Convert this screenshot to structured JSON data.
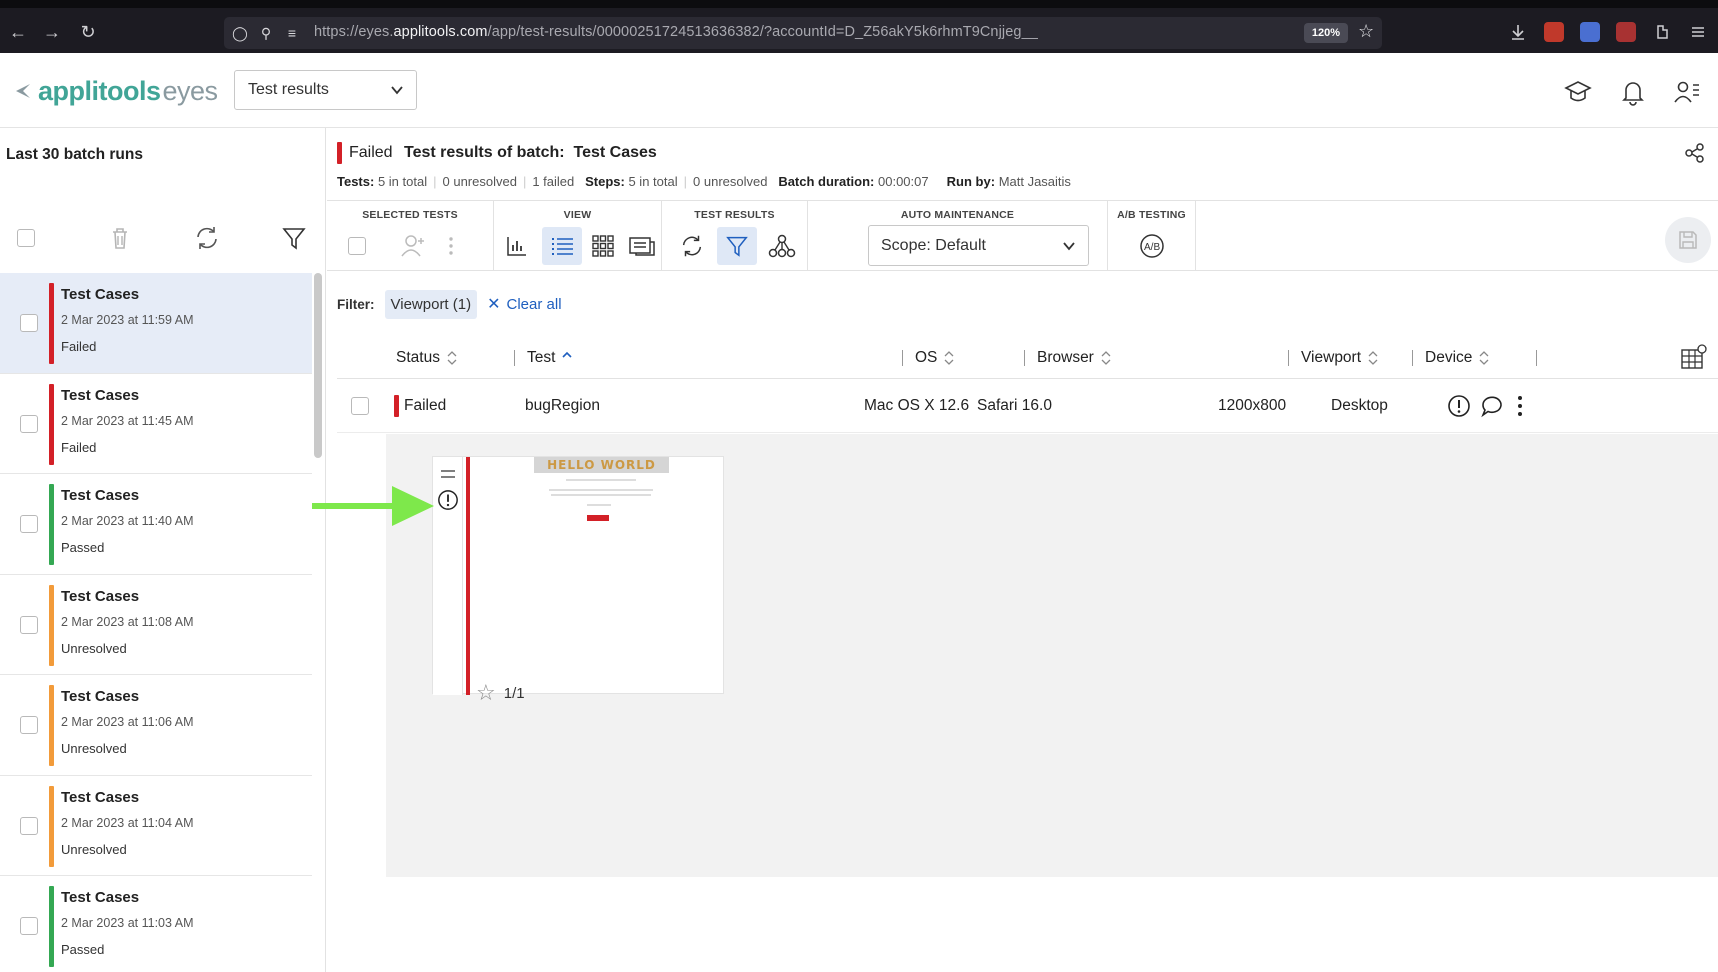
{
  "browser": {
    "url_prefix": "https://eyes.",
    "url_domain": "applitools.com",
    "url_path": "/app/test-results/00000251724513636382/?accountId=D_Z56akY5k6rhmT9Cnjjeg__",
    "zoom": "120%"
  },
  "header": {
    "logo_primary": "applitools",
    "logo_secondary": "eyes",
    "page_select": "Test results"
  },
  "sidebar": {
    "title": "Last 30 batch runs",
    "batches": [
      {
        "name": "Test Cases",
        "date": "2 Mar 2023 at 11:59 AM",
        "status": "Failed",
        "color": "#d32027",
        "active": true
      },
      {
        "name": "Test Cases",
        "date": "2 Mar 2023 at 11:45 AM",
        "status": "Failed",
        "color": "#d32027",
        "active": false
      },
      {
        "name": "Test Cases",
        "date": "2 Mar 2023 at 11:40 AM",
        "status": "Passed",
        "color": "#34a853",
        "active": false
      },
      {
        "name": "Test Cases",
        "date": "2 Mar 2023 at 11:08 AM",
        "status": "Unresolved",
        "color": "#f29b3a",
        "active": false
      },
      {
        "name": "Test Cases",
        "date": "2 Mar 2023 at 11:06 AM",
        "status": "Unresolved",
        "color": "#f29b3a",
        "active": false
      },
      {
        "name": "Test Cases",
        "date": "2 Mar 2023 at 11:04 AM",
        "status": "Unresolved",
        "color": "#f29b3a",
        "active": false
      },
      {
        "name": "Test Cases",
        "date": "2 Mar 2023 at 11:03 AM",
        "status": "Passed",
        "color": "#34a853",
        "active": false
      }
    ]
  },
  "batch": {
    "status": "Failed",
    "title_label": "Test results of batch:",
    "title_name": "Test Cases",
    "tests_label": "Tests:",
    "tests_total": "5 in total",
    "tests_unresolved": "0 unresolved",
    "tests_failed": "1 failed",
    "steps_label": "Steps:",
    "steps_total": "5 in total",
    "steps_unresolved": "0 unresolved",
    "duration_label": "Batch duration:",
    "duration": "00:00:07",
    "runby_label": "Run by:",
    "runby": "Matt Jasaitis"
  },
  "toolbar": {
    "selected_tests": "SELECTED TESTS",
    "view": "VIEW",
    "test_results": "TEST RESULTS",
    "auto_maintenance": "AUTO MAINTENANCE",
    "ab_testing": "A/B TESTING",
    "scope": "Scope: Default"
  },
  "filter": {
    "label": "Filter:",
    "chip": "Viewport (1)",
    "clear": "Clear all"
  },
  "table": {
    "columns": [
      "Status",
      "Test",
      "OS",
      "Browser",
      "Viewport",
      "Device"
    ],
    "rows": [
      {
        "status": "Failed",
        "test": "bugRegion",
        "os": "Mac OS X 12.6",
        "browser": "Safari 16.0",
        "viewport": "1200x800",
        "device": "Desktop"
      }
    ]
  },
  "thumbnail": {
    "screenshot_text": "HELLO WORLD",
    "counter": "1/1"
  },
  "colors": {
    "failed": "#d32027",
    "passed": "#34a853",
    "unresolved": "#f29b3a",
    "brand": "#41a597",
    "link": "#1f5fbf",
    "arrow": "#7ee84b"
  }
}
